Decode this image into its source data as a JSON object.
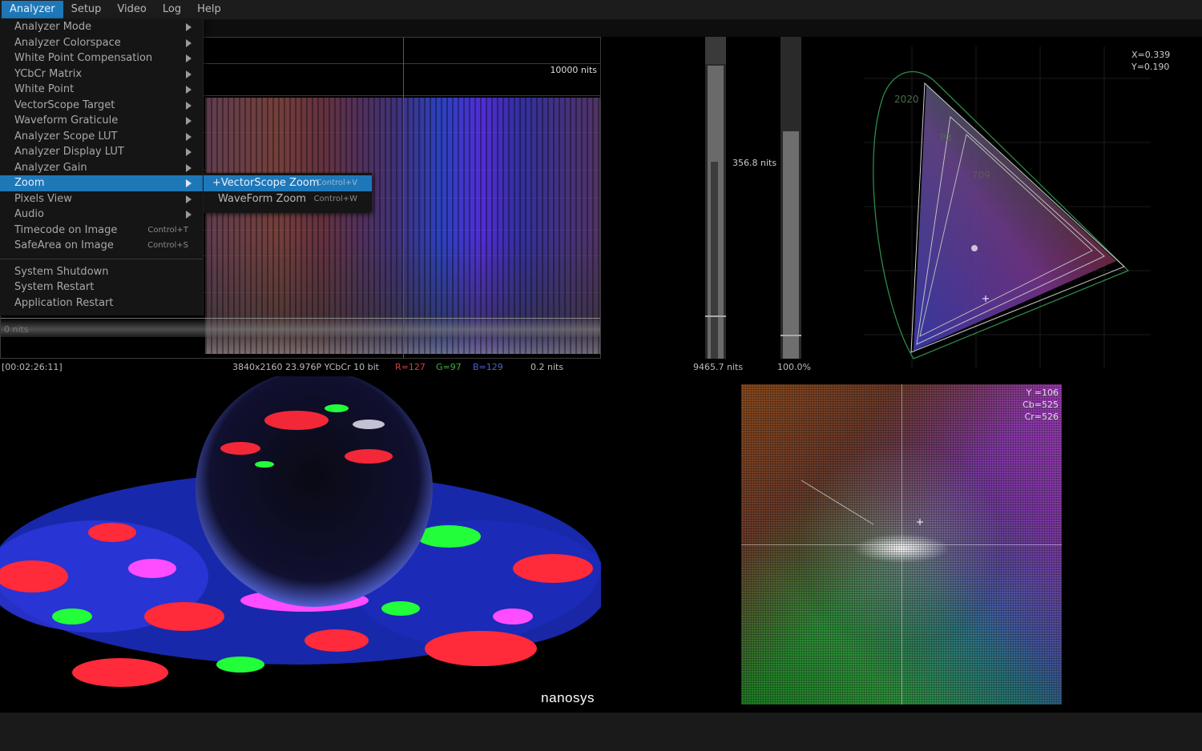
{
  "menubar": {
    "items": [
      {
        "label": "Analyzer",
        "active": true
      },
      {
        "label": "Setup"
      },
      {
        "label": "Video"
      },
      {
        "label": "Log"
      },
      {
        "label": "Help"
      }
    ]
  },
  "analyzer_menu": {
    "items": [
      {
        "label": "Analyzer Mode",
        "submenu": true
      },
      {
        "label": "Analyzer Colorspace",
        "submenu": true
      },
      {
        "label": "White Point Compensation",
        "submenu": true
      },
      {
        "label": "YCbCr Matrix",
        "submenu": true
      },
      {
        "label": "White Point",
        "submenu": true
      },
      {
        "label": "VectorScope Target",
        "submenu": true
      },
      {
        "label": "Waveform Graticule",
        "submenu": true
      },
      {
        "label": "Analyzer Scope LUT",
        "submenu": true
      },
      {
        "label": "Analyzer Display LUT",
        "submenu": true
      },
      {
        "label": "Analyzer Gain",
        "submenu": true
      },
      {
        "label": "Zoom",
        "submenu": true,
        "highlighted": true
      },
      {
        "label": "Pixels View",
        "submenu": true
      },
      {
        "label": "Audio",
        "submenu": true
      },
      {
        "label": "Timecode on Image",
        "shortcut": "Control+T"
      },
      {
        "label": "SafeArea on Image",
        "shortcut": "Control+S"
      }
    ],
    "system_items": [
      {
        "label": "System Shutdown"
      },
      {
        "label": "System Restart"
      },
      {
        "label": "Application Restart"
      }
    ]
  },
  "zoom_submenu": {
    "items": [
      {
        "label": "+VectorScope Zoom",
        "shortcut": "Control+V",
        "highlighted": true
      },
      {
        "label": "WaveForm Zoom",
        "shortcut": "Control+W"
      }
    ]
  },
  "waveform": {
    "top_label": "10000 nits",
    "bottom_label": "0 nits"
  },
  "status": {
    "timecode": "[00:02:26:11]",
    "format": "3840x2160 23.976P YCbCr 10 bit",
    "r": "R=127",
    "g": "G=97",
    "b": "B=129",
    "nits": "0.2 nits",
    "r_color": "#d04040",
    "g_color": "#40b040",
    "b_color": "#5060d0"
  },
  "meters": {
    "left_value": "356.8 nits",
    "left_bottom": "9465.7 nits",
    "right_bottom": "100.0%",
    "left_level": 0.6,
    "right_level": 0.7
  },
  "cie": {
    "x": "X=0.339",
    "y": "Y=0.190",
    "gamut_labels": [
      "2020",
      "P3",
      "709"
    ]
  },
  "vectorscope": {
    "y": "Y =106",
    "cb": "Cb=525",
    "cr": "Cr=526"
  },
  "video": {
    "logo": "nanosys"
  },
  "colors": {
    "accent": "#1e78b8"
  }
}
